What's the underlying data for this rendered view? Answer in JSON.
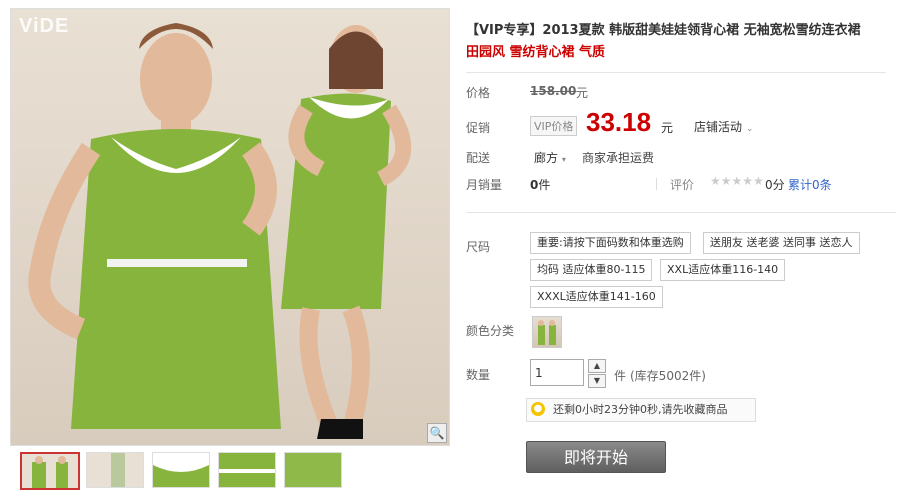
{
  "gallery": {
    "logo": "ViDE",
    "zoom_icon": "magnifier-icon"
  },
  "product": {
    "title": "【VIP专享】2013夏款 韩版甜美娃娃领背心裙 无袖宽松雪纺连衣裙",
    "subtitle": "田园风 雪纺背心裙 气质"
  },
  "price": {
    "original_label": "价格",
    "original_value": "158.00",
    "original_unit": "元",
    "promo_label": "促销",
    "vip_tag": "VIP价格",
    "promo_value": "33.18",
    "promo_unit": "元",
    "store_activity": "店铺活动"
  },
  "delivery": {
    "label": "配送",
    "from": "廊方",
    "note": "商家承担运费"
  },
  "sales": {
    "label": "月销量",
    "value": "0",
    "unit": "件",
    "rating_label": "评价",
    "stars": "★★★★★",
    "rating_value": "0分",
    "reviews": "累计0条"
  },
  "size": {
    "label": "尺码",
    "options": [
      "重要:请按下面码数和体重选购",
      "送朋友 送老婆 送同事 送恋人",
      "均码 适应体重80-115",
      "XXL适应体重116-140",
      "XXXL适应体重141-160"
    ]
  },
  "color": {
    "label": "颜色分类"
  },
  "quantity": {
    "label": "数量",
    "value": "1",
    "unit": "件",
    "stock": "(库存5002件)"
  },
  "notice": {
    "text": "还剩0小时23分钟0秒,请先收藏商品"
  },
  "buy_button": {
    "label": "即将开始"
  },
  "colors": {
    "price_red": "#cc0000",
    "dress_green": "#86b43c",
    "button_gray": "#6e6e6e"
  }
}
